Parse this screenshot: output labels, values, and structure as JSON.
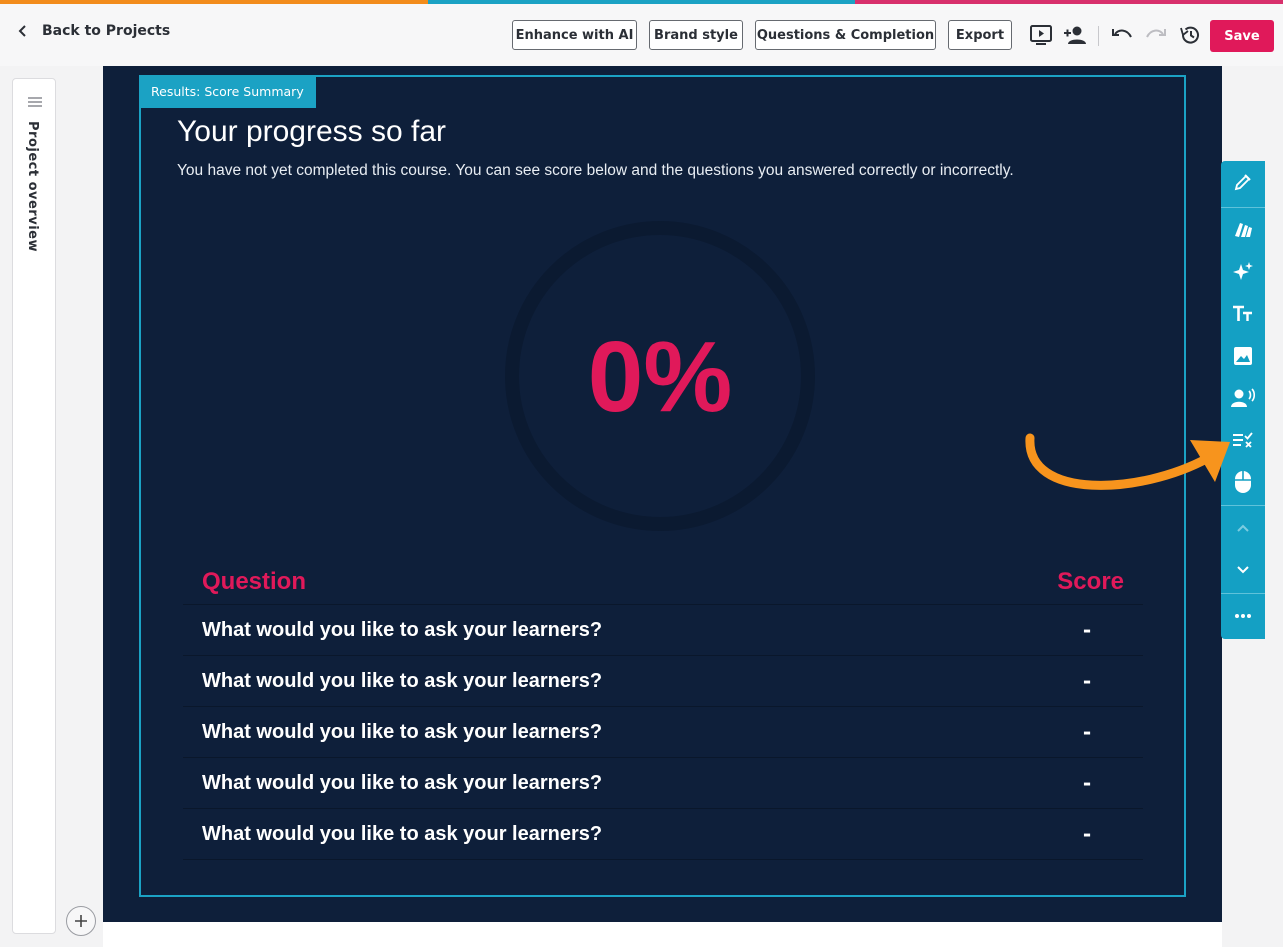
{
  "theme": {
    "stripe_colors": [
      "#f28c1c",
      "#1ba2c4",
      "#d8306c"
    ],
    "accent": "#e0195a",
    "canvas_bg": "#0e1f3a",
    "toolbar_bg": "#14a0c4",
    "annotation_arrow": "#f7941d"
  },
  "header": {
    "back_label": "Back to Projects",
    "buttons": {
      "enhance": "Enhance with AI",
      "brand": "Brand style",
      "questions": "Questions & Completion",
      "export": "Export"
    },
    "icons": [
      "preview-icon",
      "add-user-icon",
      "undo-icon",
      "redo-icon",
      "history-icon"
    ],
    "save_label": "Save"
  },
  "left_panel": {
    "label": "Project overview"
  },
  "block": {
    "tag": "Results: Score Summary",
    "title": "Your progress so far",
    "description": "You have not yet completed this course. You can see score below and the questions you answered correctly or incorrectly.",
    "score_percent": "0%",
    "table": {
      "headers": {
        "question": "Question",
        "score": "Score"
      },
      "rows": [
        {
          "question": "What would you like to ask your learners?",
          "score": "-"
        },
        {
          "question": "What would you like to ask your learners?",
          "score": "-"
        },
        {
          "question": "What would you like to ask your learners?",
          "score": "-"
        },
        {
          "question": "What would you like to ask your learners?",
          "score": "-"
        },
        {
          "question": "What would you like to ask your learners?",
          "score": "-"
        }
      ]
    }
  },
  "right_toolbar": {
    "icons": [
      "edit-icon",
      "style-icon",
      "ai-sparkle-icon",
      "text-icon",
      "image-icon",
      "voiceover-icon",
      "question-icon",
      "interaction-icon",
      "move-up-icon",
      "move-down-icon",
      "more-icon"
    ]
  }
}
